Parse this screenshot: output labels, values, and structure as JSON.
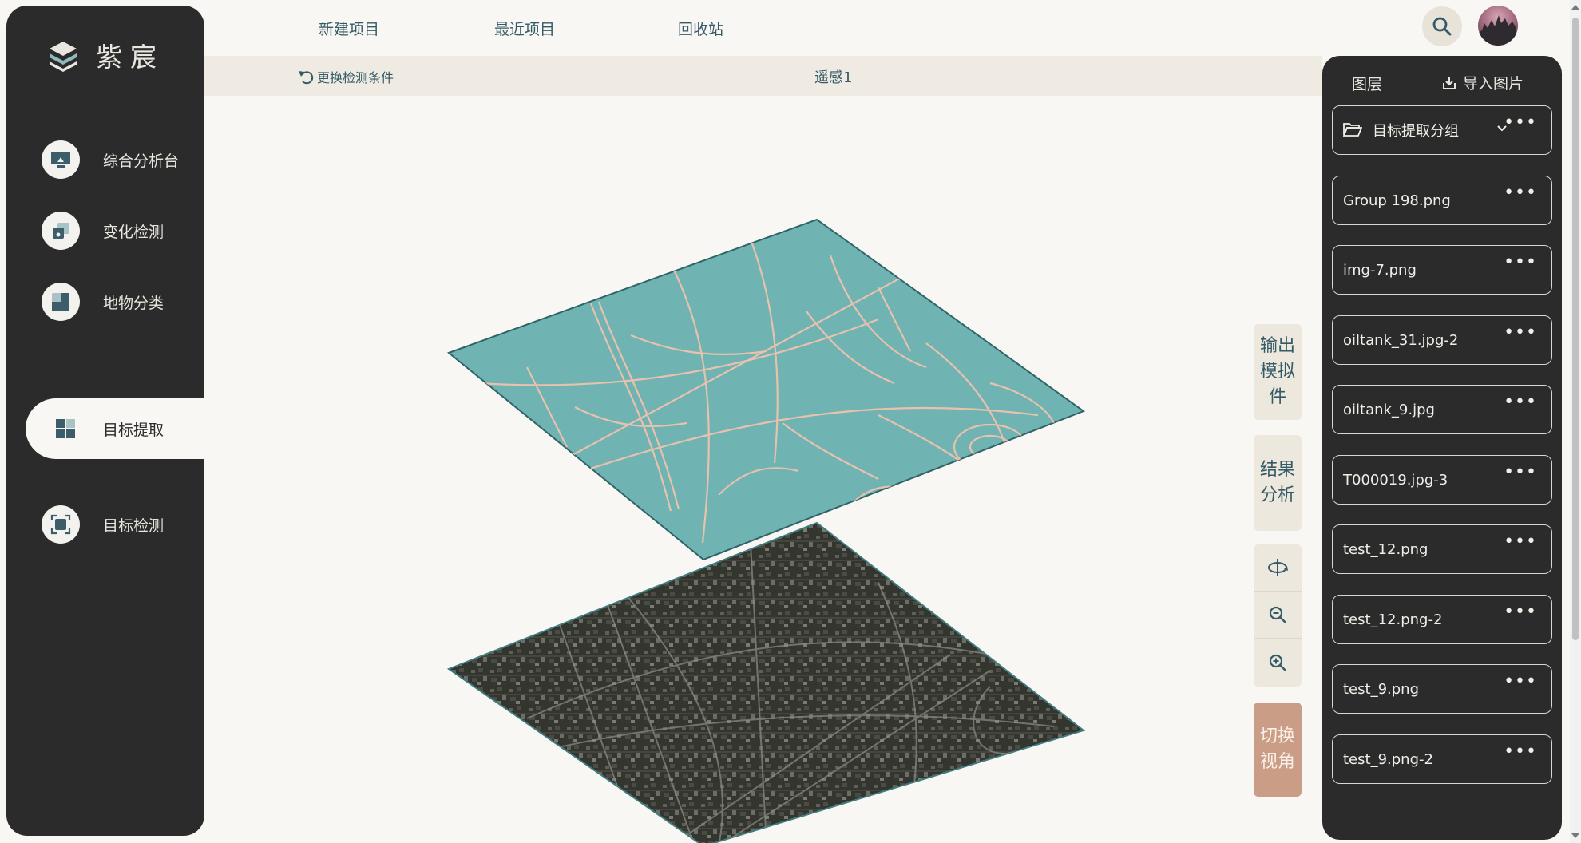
{
  "brand": {
    "name": "紫宸"
  },
  "sidebar": {
    "items": [
      {
        "label": "综合分析台",
        "icon": "monitor-icon"
      },
      {
        "label": "变化检测",
        "icon": "layers-icon"
      },
      {
        "label": "地物分类",
        "icon": "classify-icon"
      },
      {
        "label": "目标提取",
        "icon": "grid-icon",
        "active": true
      },
      {
        "label": "目标检测",
        "icon": "target-icon"
      }
    ]
  },
  "topbar": {
    "links": [
      "新建项目",
      "最近项目",
      "回收站"
    ]
  },
  "subbar": {
    "reset_label": "更换检测条件",
    "title": "遥感1"
  },
  "tools": {
    "export_label": "输出模拟件",
    "analysis_label": "结果分析",
    "switch_label": "切换视角"
  },
  "layers": {
    "title": "图层",
    "import_label": "导入图片",
    "group_name": "目标提取分组",
    "items": [
      "Group 198.png",
      "img-7.png",
      "oiltank_31.jpg-2",
      "oiltank_9.jpg",
      "T000019.jpg-3",
      "test_12.png",
      "test_12.png-2",
      "test_9.png",
      "test_9.png-2"
    ]
  },
  "colors": {
    "sidebar_bg": "#2b2b2b",
    "page_bg": "#f9f7f3",
    "accent_text": "#355a67",
    "road_layer": "#6fb3b2",
    "road_lines": "#e8c2ad",
    "switch_button": "#c99d86"
  }
}
